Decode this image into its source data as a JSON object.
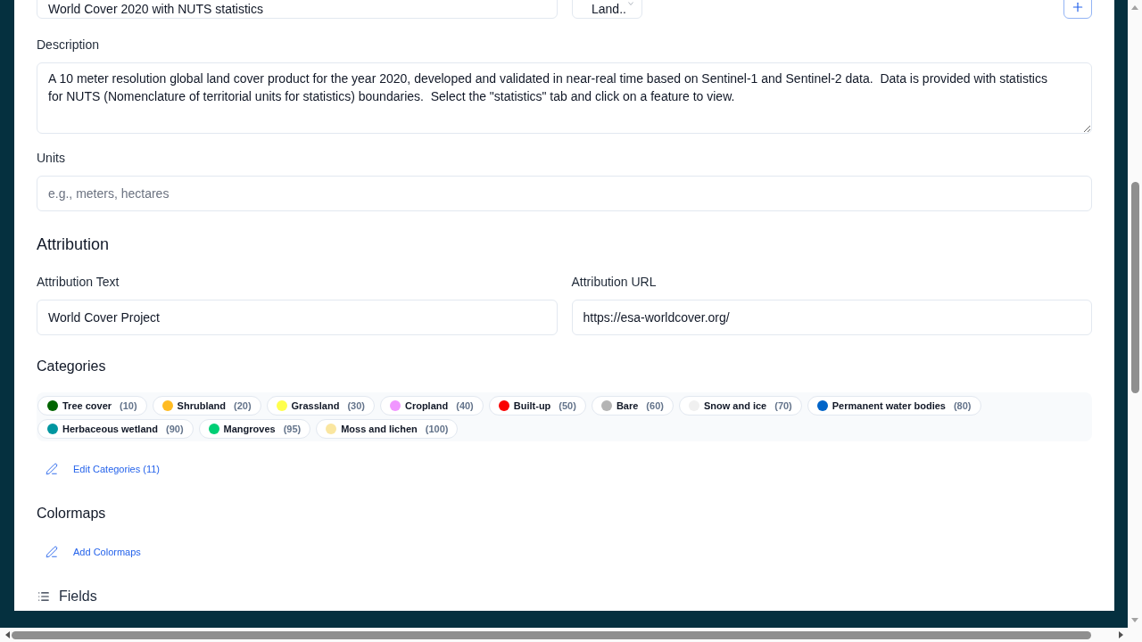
{
  "top_row": {
    "name_field": {
      "value": "World Cover 2020 with NUTS statistics"
    },
    "type_select": {
      "value": "Land.."
    }
  },
  "description": {
    "label": "Description",
    "value": "A 10 meter resolution global land cover product for the year 2020, developed and validated in near-real time based on Sentinel-1 and Sentinel-2 data.  Data is provided with statistics for NUTS (Nomenclature of territorial units for statistics) boundaries.  Select the \"statistics\" tab and click on a feature to view."
  },
  "units": {
    "label": "Units",
    "placeholder": "e.g., meters, hectares"
  },
  "attribution": {
    "heading": "Attribution",
    "text": {
      "label": "Attribution Text",
      "value": "World Cover Project"
    },
    "url": {
      "label": "Attribution URL",
      "value": "https://esa-worldcover.org/"
    }
  },
  "categories": {
    "heading": "Categories",
    "items": [
      {
        "name": "Tree cover",
        "count": "(10)",
        "color": "#006400"
      },
      {
        "name": "Shrubland",
        "count": "(20)",
        "color": "#ffbb22"
      },
      {
        "name": "Grassland",
        "count": "(30)",
        "color": "#ffff4c"
      },
      {
        "name": "Cropland",
        "count": "(40)",
        "color": "#f096ff"
      },
      {
        "name": "Built-up",
        "count": "(50)",
        "color": "#fa0000"
      },
      {
        "name": "Bare",
        "count": "(60)",
        "color": "#b4b4b4"
      },
      {
        "name": "Snow and ice",
        "count": "(70)",
        "color": "#f0f0f0"
      },
      {
        "name": "Permanent water bodies",
        "count": "(80)",
        "color": "#0064c8"
      },
      {
        "name": "Herbaceous wetland",
        "count": "(90)",
        "color": "#0096a0"
      },
      {
        "name": "Mangroves",
        "count": "(95)",
        "color": "#00cf75"
      },
      {
        "name": "Moss and lichen",
        "count": "(100)",
        "color": "#fae6a0"
      }
    ],
    "edit_link": "Edit Categories (11)"
  },
  "colormaps": {
    "heading": "Colormaps",
    "add_link": "Add Colormaps"
  },
  "fields": {
    "heading": "Fields"
  }
}
